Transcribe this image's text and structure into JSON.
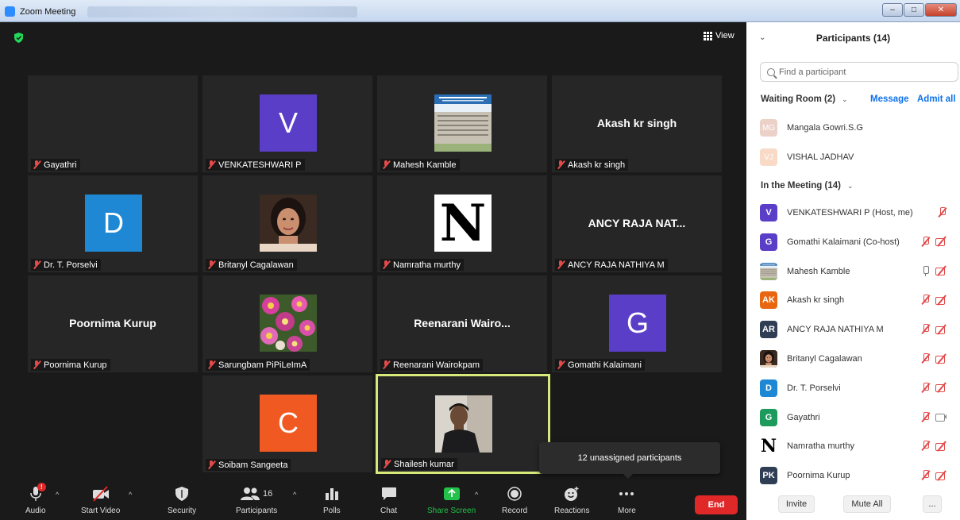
{
  "window": {
    "title": "Zoom Meeting",
    "min": "–",
    "max": "□",
    "close": "✕"
  },
  "topbar": {
    "view_label": "View"
  },
  "tiles": [
    {
      "name": "Gayathri",
      "kind": "blank"
    },
    {
      "name": "VENKATESHWARI P",
      "kind": "avatar",
      "letter": "V",
      "color": "#5b3ec8"
    },
    {
      "name": "Mahesh Kamble",
      "kind": "photo",
      "photo": "building"
    },
    {
      "name": "Akash kr singh",
      "kind": "text",
      "display": "Akash kr singh"
    },
    {
      "name": "Dr. T. Porselvi",
      "kind": "avatar",
      "letter": "D",
      "color": "#1e88d4"
    },
    {
      "name": "Britanyl Cagalawan",
      "kind": "photo",
      "photo": "woman"
    },
    {
      "name": "Namratha murthy",
      "kind": "letter-logo",
      "letter": "N"
    },
    {
      "name": "ANCY RAJA NATHIYA M",
      "kind": "text",
      "display": "ANCY RAJA NAT..."
    },
    {
      "name": "Poornima Kurup",
      "kind": "text",
      "display": "Poornima Kurup"
    },
    {
      "name": "Sarungbam PiPiLeImA",
      "kind": "photo",
      "photo": "flowers"
    },
    {
      "name": "Reenarani Wairokpam",
      "kind": "text",
      "display": "Reenarani Wairo..."
    },
    {
      "name": "Gomathi Kalaimani",
      "kind": "avatar",
      "letter": "G",
      "color": "#5b3ec8"
    },
    {
      "name": "Soibam Sangeeta",
      "kind": "avatar",
      "letter": "C",
      "color": "#f05a22"
    },
    {
      "name": "Shailesh kumar",
      "kind": "photo",
      "photo": "man",
      "active": true
    }
  ],
  "toast": "12 unassigned participants",
  "toolbar": {
    "audio": "Audio",
    "audio_badge": "!",
    "start_video": "Start Video",
    "security": "Security",
    "participants": "Participants",
    "participants_count": "16",
    "polls": "Polls",
    "chat": "Chat",
    "share_screen": "Share Screen",
    "record": "Record",
    "reactions": "Reactions",
    "more": "More",
    "end": "End"
  },
  "panel": {
    "title": "Participants (14)",
    "search_placeholder": "Find a participant",
    "waiting_room_label": "Waiting Room (2)",
    "message": "Message",
    "admit_all": "Admit all",
    "waiting": [
      {
        "initials": "MG",
        "name": "Mangala Gowri.S.G",
        "color": "#e9c9bf"
      },
      {
        "initials": "VJ",
        "name": "VISHAL JADHAV",
        "color": "#f7d4bd"
      }
    ],
    "in_meeting_label": "In the Meeting (14)",
    "members": [
      {
        "initials": "V",
        "name": "VENKATESHWARI P (Host, me)",
        "color": "#5b3ec8",
        "mic": "off",
        "cam": "none"
      },
      {
        "initials": "G",
        "name": "Gomathi Kalaimani (Co-host)",
        "color": "#5b3ec8",
        "mic": "off",
        "cam": "off"
      },
      {
        "initials": "",
        "name": "Mahesh Kamble",
        "color": "#b9c7d6",
        "mic": "on",
        "cam": "off",
        "photo": "building"
      },
      {
        "initials": "AK",
        "name": "Akash kr singh",
        "color": "#e8660f",
        "mic": "off",
        "cam": "off"
      },
      {
        "initials": "AR",
        "name": "ANCY RAJA NATHIYA M",
        "color": "#2f3e55",
        "mic": "off",
        "cam": "off"
      },
      {
        "initials": "",
        "name": "Britanyl Cagalawan",
        "color": "#7a4a3a",
        "mic": "off",
        "cam": "off",
        "photo": "woman"
      },
      {
        "initials": "D",
        "name": "Dr. T. Porselvi",
        "color": "#1e88d4",
        "mic": "off",
        "cam": "off"
      },
      {
        "initials": "G",
        "name": "Gayathri",
        "color": "#1c9b5c",
        "mic": "off",
        "cam": "on"
      },
      {
        "initials": "N",
        "name": "Namratha murthy",
        "color": "#ffffff",
        "mic": "off",
        "cam": "off",
        "logo": true
      },
      {
        "initials": "PK",
        "name": "Poornima Kurup",
        "color": "#2f3e55",
        "mic": "off",
        "cam": "off"
      }
    ],
    "invite": "Invite",
    "mute_all": "Mute All",
    "more": "..."
  }
}
